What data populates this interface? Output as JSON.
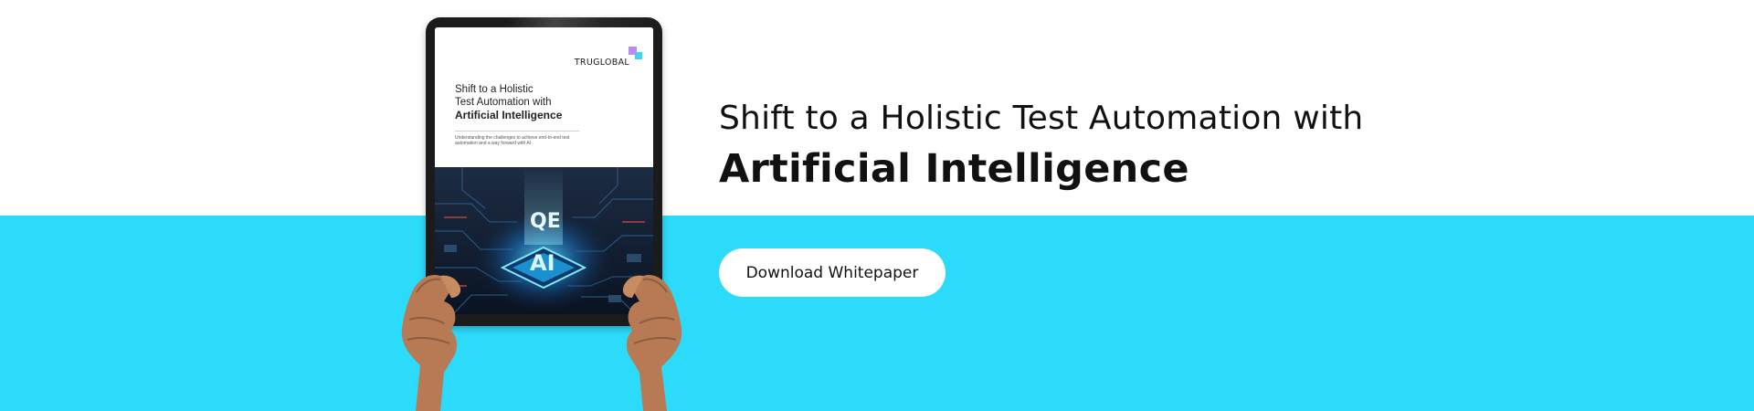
{
  "banner": {
    "headline_line1": "Shift to a Holistic Test Automation with",
    "headline_line2": "Artificial Intelligence",
    "cta_label": "Download Whitepaper",
    "colors": {
      "top_background": "#ffffff",
      "bottom_background": "#2cdafa",
      "button_background": "#ffffff",
      "text": "#111111"
    }
  },
  "tablet_document": {
    "logo_text": "TRUGLOBAL",
    "title_line1": "Shift to a Holistic",
    "title_line2": "Test Automation with",
    "title_line3": "Artificial Intelligence",
    "subtitle": "Understanding the challenges to achieve end-to-end test automation and a way forward with AI",
    "artwork_labels": {
      "chip_top": "QE",
      "chip_bottom": "AI"
    }
  }
}
